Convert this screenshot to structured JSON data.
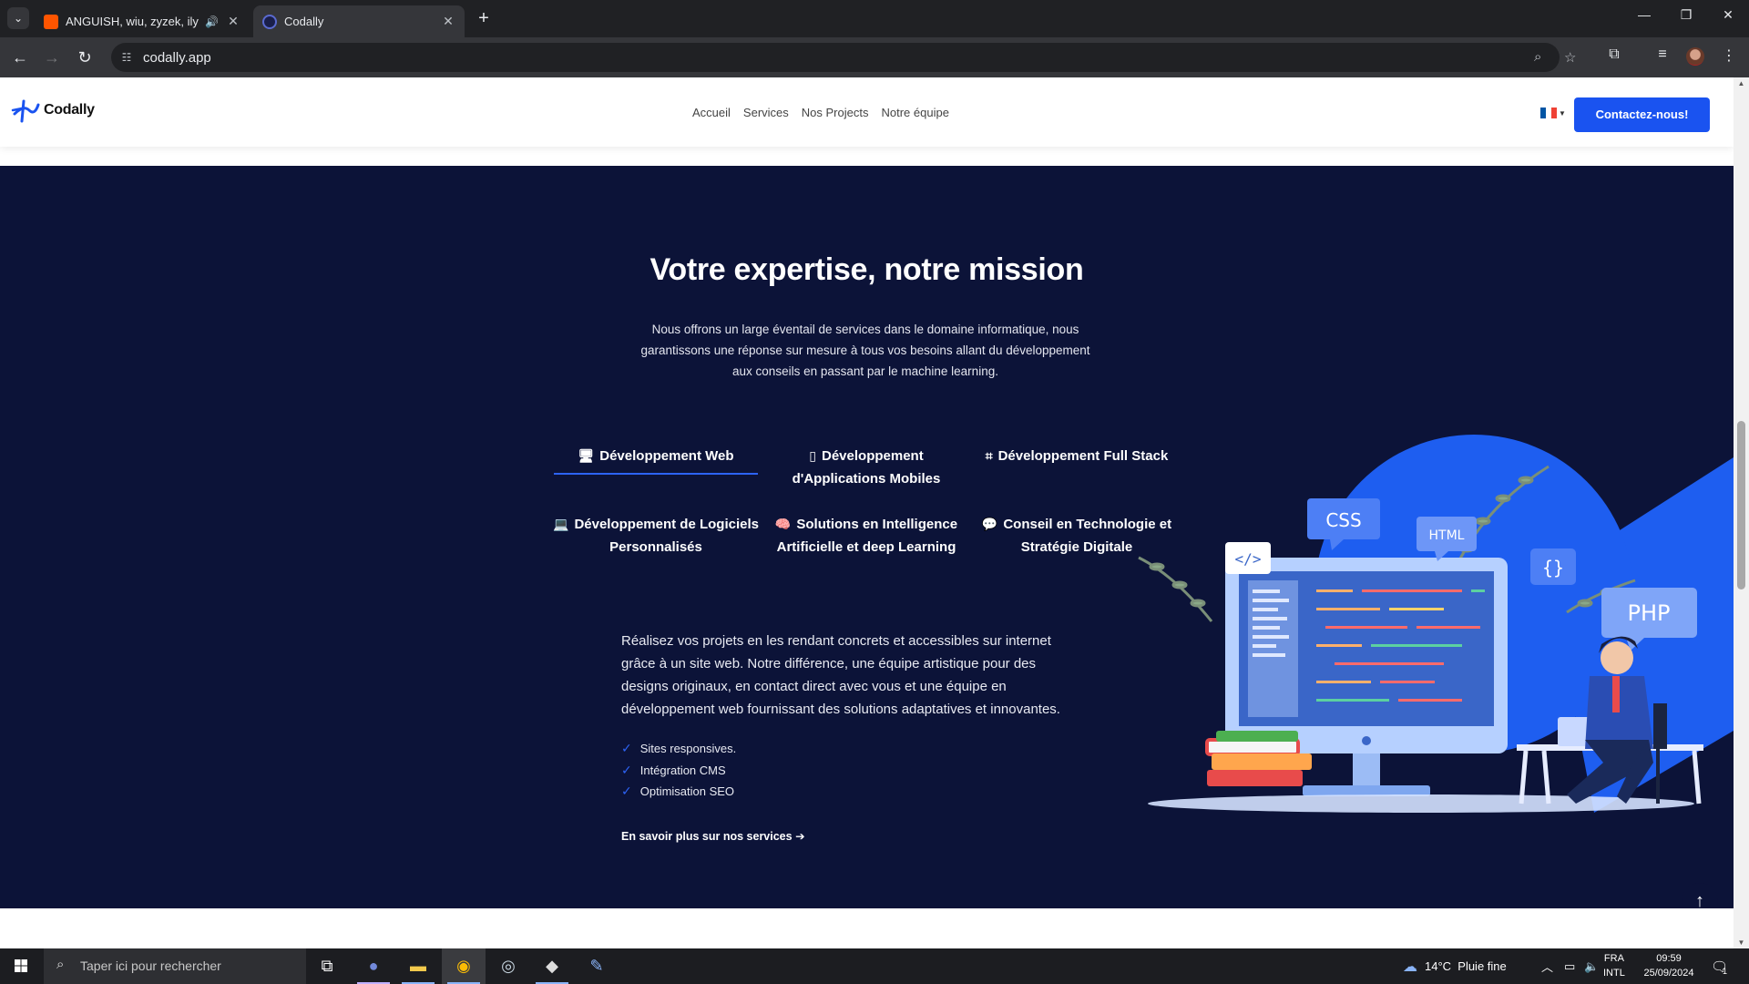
{
  "browser": {
    "tabs": [
      {
        "title": "ANGUISH, wiu, zyzek, ily – I",
        "favicon_color": "#ff5500",
        "audio": true
      },
      {
        "title": "Codally",
        "favicon_color": "#1a1f4a",
        "active": true
      }
    ],
    "url": "codally.app"
  },
  "site": {
    "logo_text": "Codally",
    "nav": [
      "Accueil",
      "Services",
      "Nos Projects",
      "Notre équipe"
    ],
    "cta": "Contactez-nous!"
  },
  "hero": {
    "title": "Votre expertise, notre mission",
    "intro": "Nous offrons un large éventail de services dans le domaine informatique, nous garantissons une réponse sur mesure à tous vos besoins allant du développement aux conseils en passant par le machine learning.",
    "services": [
      {
        "label": "Développement Web",
        "icon": "monitor-icon",
        "glyph": "🖥",
        "active": true
      },
      {
        "label": "Développement d'Applications Mobiles",
        "icon": "mobile-icon",
        "glyph": "▯"
      },
      {
        "label": "Développement Full Stack",
        "icon": "crop-icon",
        "glyph": "⌗"
      },
      {
        "label": "Développement de Logiciels Personnalisés",
        "icon": "laptop-icon",
        "glyph": "💻"
      },
      {
        "label": "Solutions en Intelligence Artificielle et deep Learning",
        "icon": "brain-icon",
        "glyph": "🧠"
      },
      {
        "label": "Conseil en Technologie et Stratégie Digitale",
        "icon": "comments-icon",
        "glyph": "💬"
      }
    ],
    "description": "Réalisez vos projets en les rendant concrets et accessibles sur internet grâce à un site web. Notre différence, une équipe artistique pour des designs originaux, en contact direct avec vous et une équipe en développement web fournissant des solutions adaptatives et innovantes.",
    "features": [
      "Sites responsives.",
      "Intégration CMS",
      "Optimisation SEO"
    ],
    "more_link": "En savoir plus sur nos services",
    "illustration_labels": {
      "css": "CSS",
      "html": "HTML",
      "code": "</>",
      "braces": "{}",
      "php": "PHP"
    }
  },
  "taskbar": {
    "search_placeholder": "Taper ici pour rechercher",
    "weather": "14°C  Pluie fine",
    "lang": [
      "FRA",
      "INTL"
    ],
    "time": "09:59",
    "date": "25/09/2024",
    "notification_count": "1"
  },
  "colors": {
    "accent": "#1a53f0",
    "hero_bg": "#0c1338",
    "illustration_blue": "#1e5ef0"
  }
}
